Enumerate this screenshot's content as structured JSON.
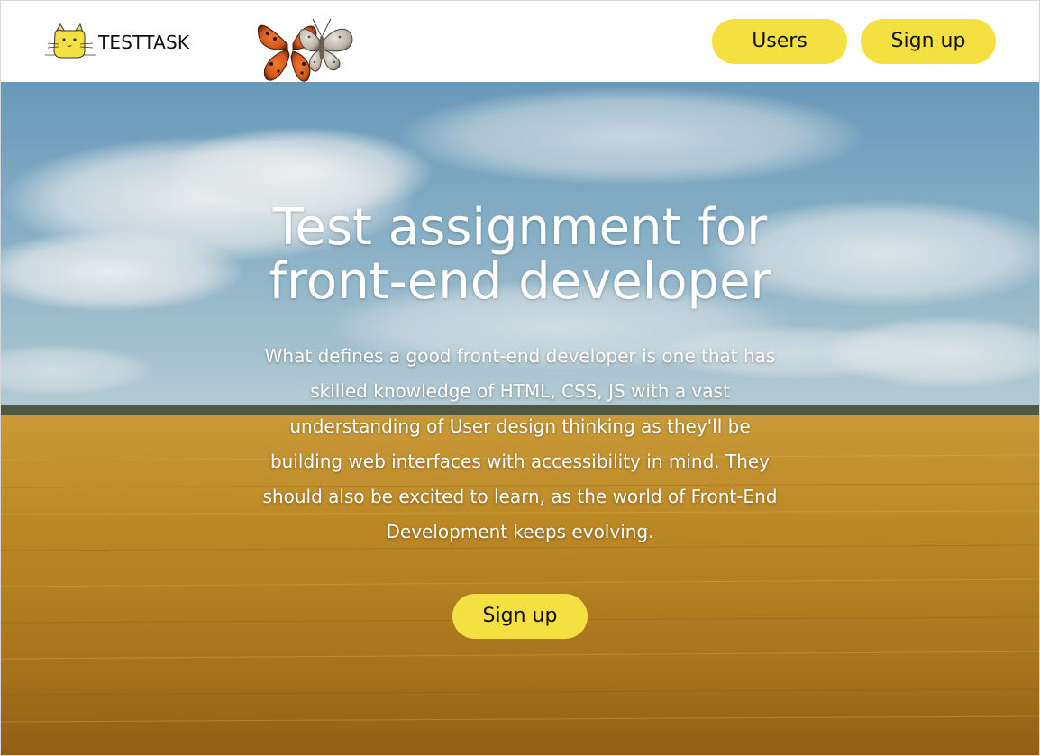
{
  "header": {
    "logo_text": "TESTTASK",
    "logo_icon": "cat-logo-icon",
    "decoration": "butterfly-image",
    "nav": {
      "users_label": "Users",
      "signup_label": "Sign up"
    }
  },
  "hero": {
    "title_line1": "Test assignment for",
    "title_line2": "front-end developer",
    "description": "What defines a good front-end developer is one that has skilled knowledge of HTML, CSS, JS with a vast understanding of User design thinking as they'll be building web interfaces with accessibility in mind. They should also be excited to learn, as the world of Front-End Development keeps evolving.",
    "cta_label": "Sign up",
    "background": "wheat-field-sky-image"
  },
  "colors": {
    "accent": "#f4e041",
    "text_dark": "#111111",
    "text_light": "#ffffff"
  }
}
